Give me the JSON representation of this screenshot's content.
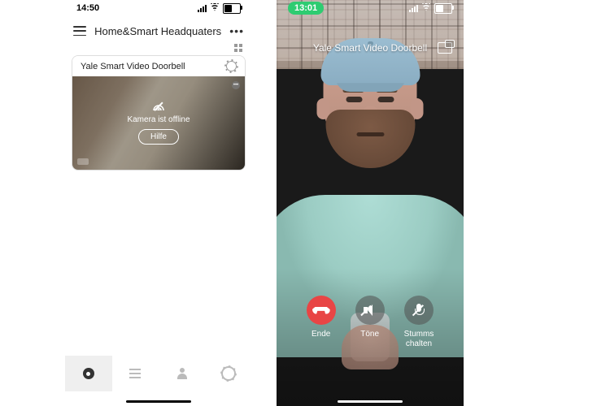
{
  "left": {
    "status": {
      "time": "14:50"
    },
    "header": {
      "title": "Home&Smart Headquaters"
    },
    "card": {
      "title": "Yale Smart Video Doorbell",
      "offline_text": "Kamera ist offline",
      "help_label": "Hilfe"
    }
  },
  "right": {
    "status": {
      "time": "13:01"
    },
    "title": "Yale Smart Video Doorbell",
    "controls": {
      "end": "Ende",
      "tones": "Töne",
      "mute": "Stumms\nchalten"
    }
  }
}
